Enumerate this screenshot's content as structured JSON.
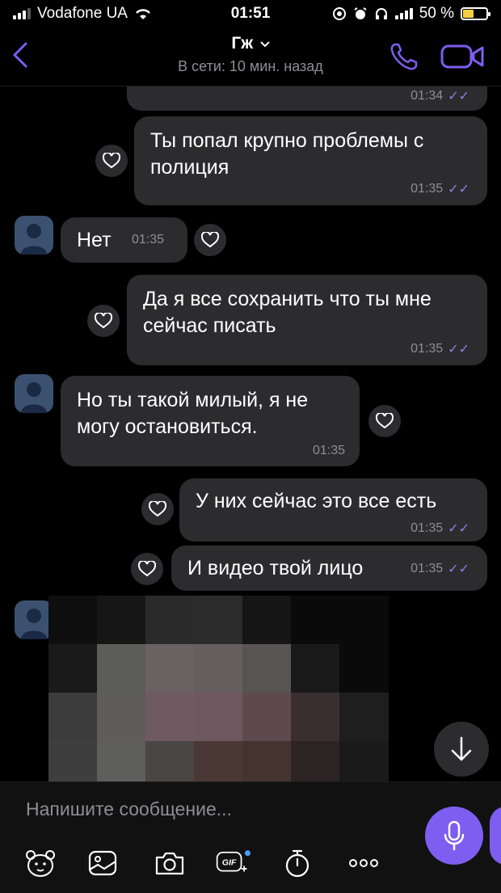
{
  "status_bar": {
    "carrier": "Vodafone UA",
    "time": "01:51",
    "battery": "50 %",
    "battery_level": 0.5
  },
  "header": {
    "contact_name": "Гж",
    "presence": "В сети: 10 мин. назад"
  },
  "messages": [
    {
      "side": "out",
      "text": "",
      "time": "01:34"
    },
    {
      "side": "out",
      "text": "Ты попал крупно проблемы с полиция",
      "time": "01:35"
    },
    {
      "side": "in",
      "text": "Нет",
      "time": "01:35"
    },
    {
      "side": "out",
      "text": "Да я все сохранить что ты мне сейчас писать",
      "time": "01:35"
    },
    {
      "side": "in",
      "text": "Но ты такой милый, я не могу остановиться.",
      "time": "01:35"
    },
    {
      "side": "out",
      "text": "У них сейчас это все есть",
      "time": "01:35"
    },
    {
      "side": "out",
      "text": "И видео твой лицо",
      "time": "01:35"
    }
  ],
  "composer": {
    "placeholder": "Напишите сообщение...",
    "gif_label": "GIF"
  },
  "colors": {
    "accent": "#7d5ef0",
    "bubble": "#2c2c2e",
    "read_check": "#8c7ee8"
  }
}
